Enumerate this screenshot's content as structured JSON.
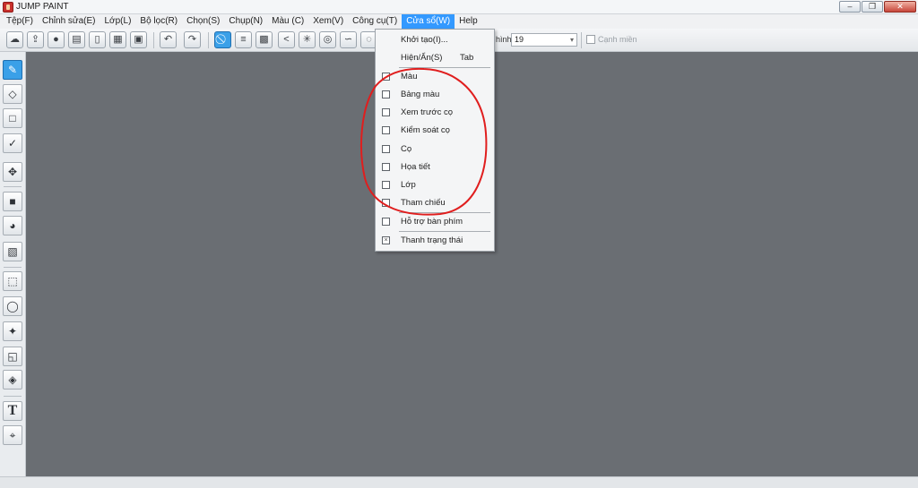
{
  "window": {
    "title": "JUMP PAINT"
  },
  "menubar": {
    "items": [
      {
        "label": "Tệp(F)"
      },
      {
        "label": "Chỉnh sửa(E)"
      },
      {
        "label": "Lớp(L)"
      },
      {
        "label": "Bộ lọc(R)"
      },
      {
        "label": "Chọn(S)"
      },
      {
        "label": "Chụp(N)"
      },
      {
        "label": "Màu (C)"
      },
      {
        "label": "Xem(V)"
      },
      {
        "label": "Công cụ(T)"
      },
      {
        "label": "Cửa sổ(W)",
        "active": true
      },
      {
        "label": "Help"
      }
    ]
  },
  "toolbar": {
    "size_label": "hình",
    "size_value": "19",
    "edge_label": "Cạnh miền"
  },
  "window_menu": {
    "items": [
      {
        "label": "Khởi tạo(I)...",
        "shortcut": "",
        "checkbox": false
      },
      {
        "label": "Hiện/Ẩn(S)",
        "shortcut": "Tab",
        "checkbox": false
      },
      {
        "label": "Màu",
        "checkbox": true,
        "checked": false
      },
      {
        "label": "Bảng màu",
        "checkbox": true,
        "checked": false
      },
      {
        "label": "Xem trước cọ",
        "checkbox": true,
        "checked": false
      },
      {
        "label": "Kiểm soát cọ",
        "checkbox": true,
        "checked": false
      },
      {
        "label": "Cọ",
        "checkbox": true,
        "checked": false
      },
      {
        "label": "Họa tiết",
        "checkbox": true,
        "checked": false
      },
      {
        "label": "Lớp",
        "checkbox": true,
        "checked": false
      },
      {
        "label": "Tham chiếu",
        "checkbox": true,
        "checked": false
      },
      {
        "label": "Hỗ trợ bàn phím",
        "checkbox": true,
        "checked": false
      },
      {
        "label": "Thanh trạng thái",
        "checkbox": true,
        "checked": true
      }
    ]
  },
  "colors": {
    "accent": "#3399ff",
    "canvas": "#6a6e73",
    "annotation": "#e01e1e"
  }
}
